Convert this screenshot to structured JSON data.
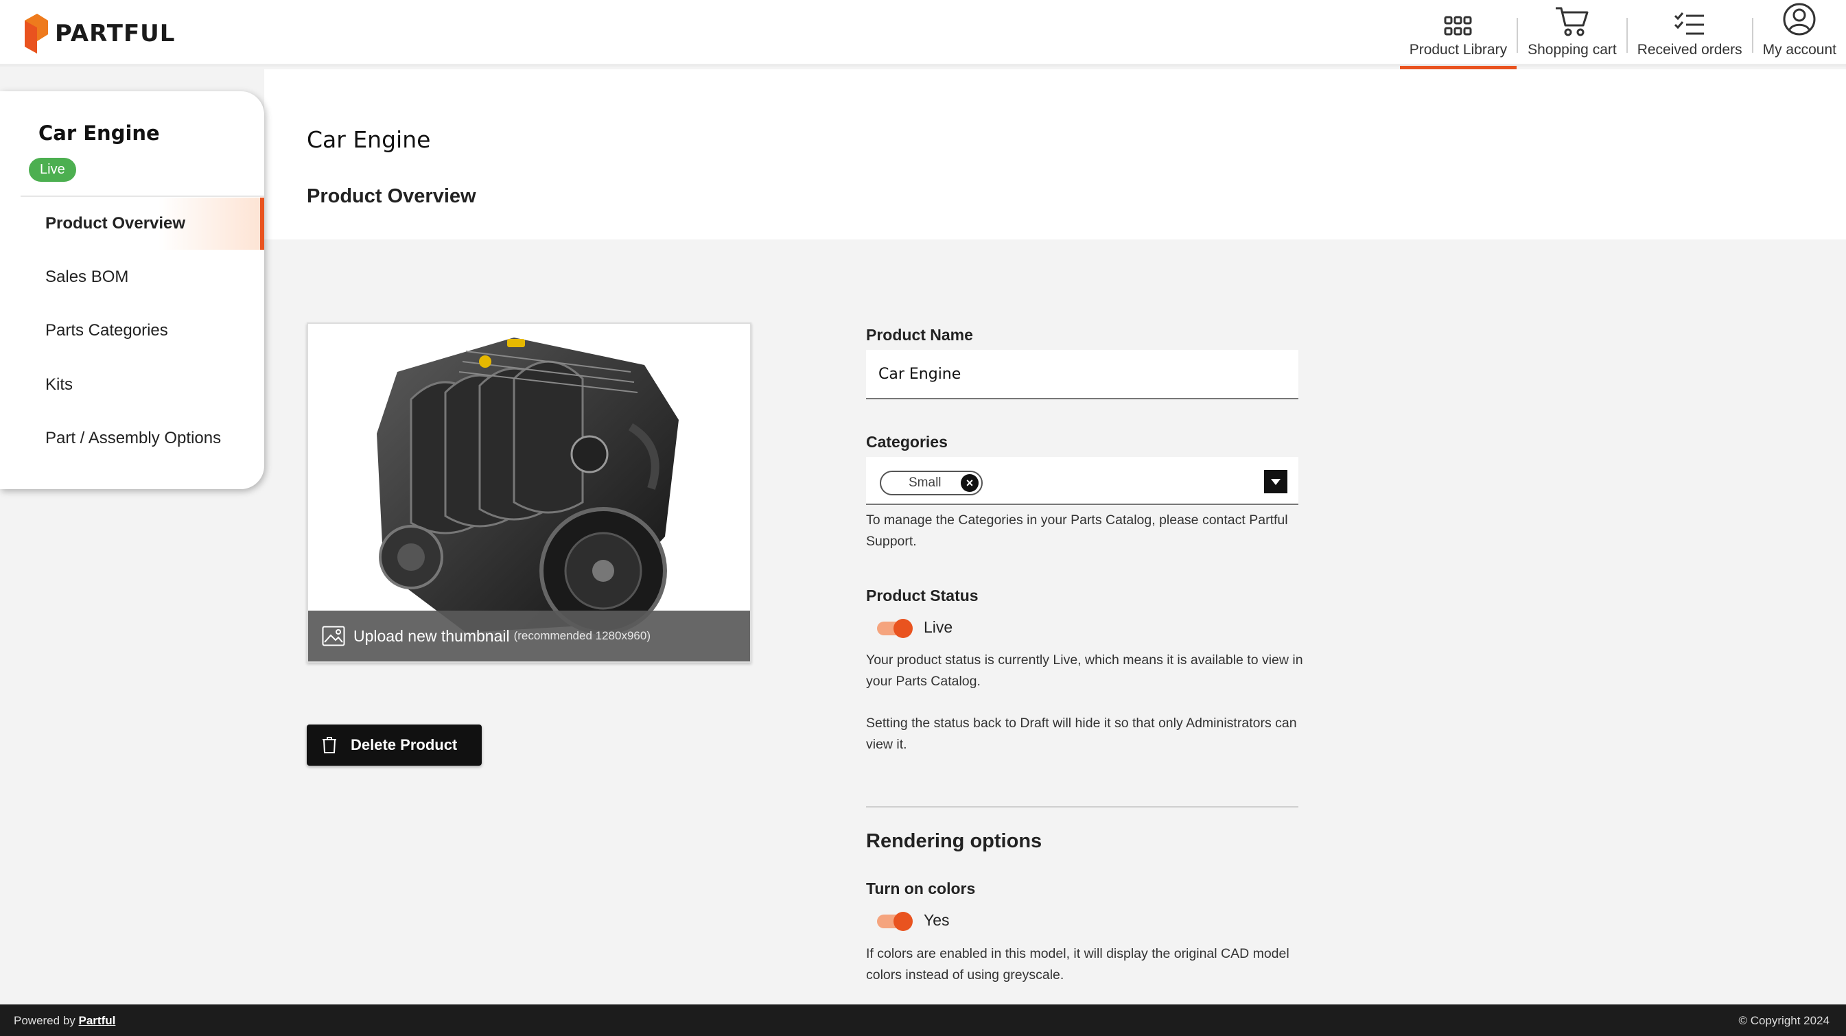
{
  "brand": {
    "name": "PARTFUL",
    "accent": "#e9531f"
  },
  "nav": [
    {
      "label": "Product Library",
      "icon": "grid-icon",
      "active": true
    },
    {
      "label": "Shopping cart",
      "icon": "cart-icon"
    },
    {
      "label": "Received orders",
      "icon": "checklist-icon"
    },
    {
      "label": "My account",
      "icon": "user-circle-icon"
    }
  ],
  "sidebar": {
    "title": "Car Engine",
    "status_badge": "Live",
    "items": [
      {
        "label": "Product Overview",
        "active": true
      },
      {
        "label": "Sales BOM"
      },
      {
        "label": "Parts Categories"
      },
      {
        "label": "Kits"
      },
      {
        "label": "Part / Assembly Options"
      }
    ]
  },
  "main": {
    "title": "Car Engine",
    "section_title": "Product Overview",
    "thumbnail": {
      "upload_label": "Upload new thumbnail",
      "upload_hint": "(recommended 1280x960)"
    },
    "delete_label": "Delete Product"
  },
  "form": {
    "product_name_label": "Product Name",
    "product_name_value": "Car Engine",
    "categories_label": "Categories",
    "categories_selected": "Small",
    "categories_help": "To manage the Categories in your Parts Catalog, please contact Partful Support.",
    "status_label": "Product Status",
    "status_value": "Live",
    "status_help_1": "Your product status is currently Live, which means it is available to view in your Parts Catalog.",
    "status_help_2": "Setting the status back to Draft will hide it so that only Administrators can view it.",
    "rendering_title": "Rendering options",
    "colors_label": "Turn on colors",
    "colors_value": "Yes",
    "colors_help": "If colors are enabled in this model, it will display the original CAD model colors instead of using greyscale."
  },
  "footer": {
    "powered_by": "Powered by",
    "powered_link": "Partful",
    "copyright": "© Copyright 2024"
  }
}
